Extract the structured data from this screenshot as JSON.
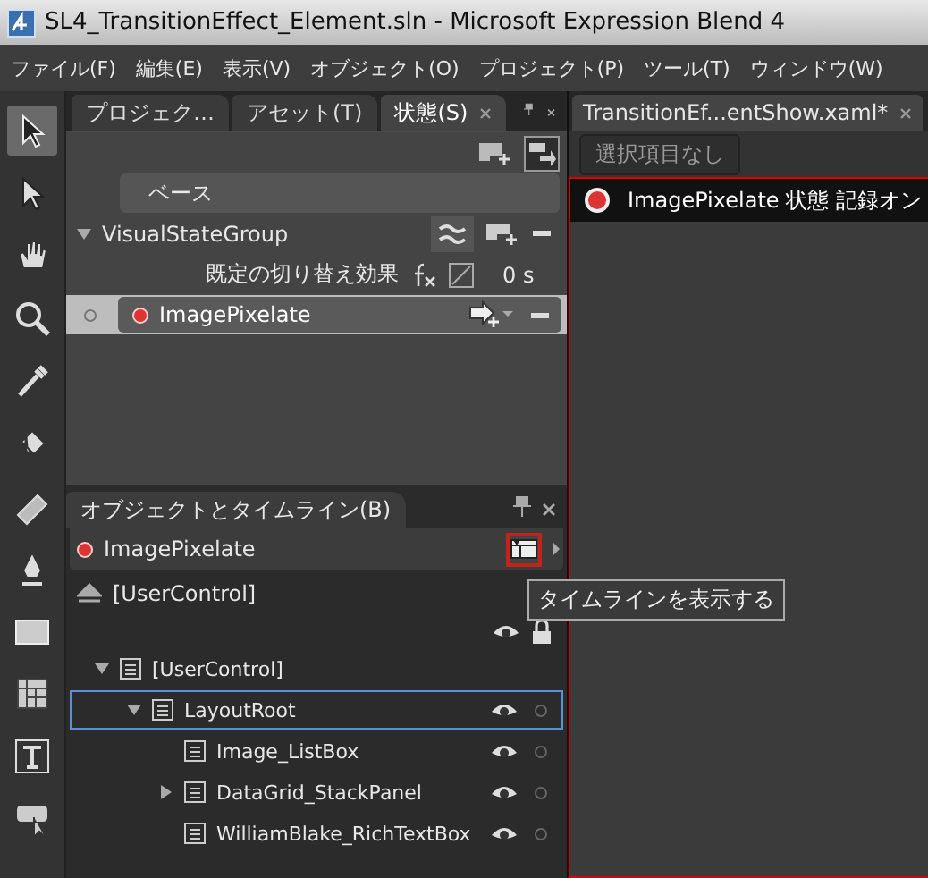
{
  "window": {
    "title": "SL4_TransitionEffect_Element.sln - Microsoft Expression Blend 4"
  },
  "menu": [
    "ファイル(F)",
    "編集(E)",
    "表示(V)",
    "オブジェクト(O)",
    "プロジェクト(P)",
    "ツール(T)",
    "ウィンドウ(W)"
  ],
  "toolbox": [
    {
      "kind": "select",
      "selected": true
    },
    {
      "kind": "direct",
      "selected": false
    },
    {
      "kind": "hand",
      "selected": false
    },
    {
      "kind": "zoom",
      "selected": false
    },
    {
      "kind": "eyedropper",
      "selected": false
    },
    {
      "kind": "bucket",
      "selected": false
    },
    {
      "kind": "gradient",
      "selected": false
    },
    {
      "kind": "pen",
      "selected": false
    },
    {
      "kind": "rectangle",
      "selected": false
    },
    {
      "kind": "grid",
      "selected": false
    },
    {
      "kind": "text",
      "selected": false
    },
    {
      "kind": "control",
      "selected": false
    }
  ],
  "states_panel": {
    "tabs": [
      {
        "label": "プロジェク…",
        "selected": false
      },
      {
        "label": "アセット(T)",
        "selected": false
      },
      {
        "label": "状態(S)",
        "selected": true
      }
    ],
    "base_state": "ベース",
    "group": {
      "name": "VisualStateGroup",
      "expanded": true,
      "transition_label": "既定の切り替え効果",
      "duration": "0 s",
      "states": [
        {
          "name": "ImagePixelate",
          "selected": true,
          "recording": true
        }
      ]
    }
  },
  "objects_panel": {
    "title": "オブジェクトとタイムライン(B)",
    "storyboard": "ImagePixelate",
    "scope": "[UserControl]",
    "tooltip": "タイムラインを表示する",
    "tree": [
      {
        "name": "[UserControl]",
        "expandable": true,
        "expanded": true,
        "selected": false,
        "children": [
          {
            "name": "LayoutRoot",
            "expandable": true,
            "expanded": true,
            "selected": true,
            "children": [
              {
                "name": "Image_ListBox",
                "expandable": false,
                "expanded": false,
                "selected": false
              },
              {
                "name": "DataGrid_StackPanel",
                "expandable": true,
                "expanded": false,
                "selected": false
              },
              {
                "name": "WilliamBlake_RichTextBox",
                "expandable": false,
                "expanded": false,
                "selected": false
              }
            ]
          }
        ]
      }
    ]
  },
  "document": {
    "tab": "TransitionEf...entShow.xaml*",
    "breadcrumb": "選択項目なし",
    "recording_label": "ImagePixelate 状態 記録オン"
  }
}
